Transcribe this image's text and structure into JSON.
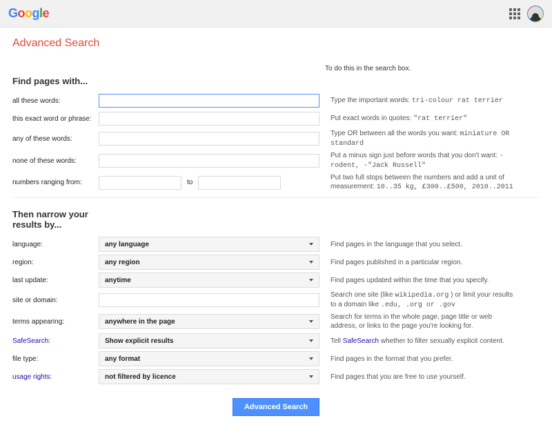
{
  "header": {
    "logo_text": "Google"
  },
  "page_title": "Advanced Search",
  "section_find": "Find pages with...",
  "tip_header": "To do this in the search box.",
  "fields": {
    "all_words": {
      "label": "all these words:",
      "value": "",
      "tip_pre": "Type the important words: ",
      "tip_code": "tri-colour rat terrier"
    },
    "exact": {
      "label": "this exact word or phrase:",
      "value": "",
      "tip_pre": "Put exact words in quotes: ",
      "tip_code": "\"rat terrier\""
    },
    "any": {
      "label": "any of these words:",
      "value": "",
      "tip_pre": "Type OR between all the words you want: ",
      "tip_code": "miniature OR standard"
    },
    "none": {
      "label": "none of these words:",
      "value": "",
      "tip_pre": "Put a minus sign just before words that you don't want: ",
      "tip_code": "-rodent, -\"Jack Russell\""
    },
    "numbers": {
      "label": "numbers ranging from:",
      "from": "",
      "to_label": "to",
      "to": "",
      "tip_pre": "Put two full stops between the numbers and add a unit of measurement: ",
      "tip_code": "10..35 kg, £300..£500, 2010..2011"
    }
  },
  "section_narrow": "Then narrow your results by...",
  "narrow": {
    "language": {
      "label": "language:",
      "value": "any language",
      "tip": "Find pages in the language that you select."
    },
    "region": {
      "label": "region:",
      "value": "any region",
      "tip": "Find pages published in a particular region."
    },
    "last_update": {
      "label": "last update:",
      "value": "anytime",
      "tip": "Find pages updated within the time that you specify."
    },
    "site": {
      "label": "site or domain:",
      "value": "",
      "tip_pre": "Search one site (like ",
      "tip_code": "wikipedia.org",
      "tip_mid": " ) or limit your results to a domain like ",
      "tip_code2": ".edu, .org or .gov"
    },
    "terms": {
      "label": "terms appearing:",
      "value": "anywhere in the page",
      "tip": "Search for terms in the whole page, page title or web address, or links to the page you're looking for."
    },
    "safesearch": {
      "label": "SafeSearch:",
      "value": "Show explicit results",
      "tip_pre": "Tell ",
      "tip_link": "SafeSearch",
      "tip_post": " whether to filter sexually explicit content."
    },
    "filetype": {
      "label": "file type:",
      "value": "any format",
      "tip": "Find pages in the format that you prefer."
    },
    "usage": {
      "label": "usage rights:",
      "value": "not filtered by licence",
      "tip": "Find pages that you are free to use yourself."
    }
  },
  "submit_label": "Advanced Search"
}
